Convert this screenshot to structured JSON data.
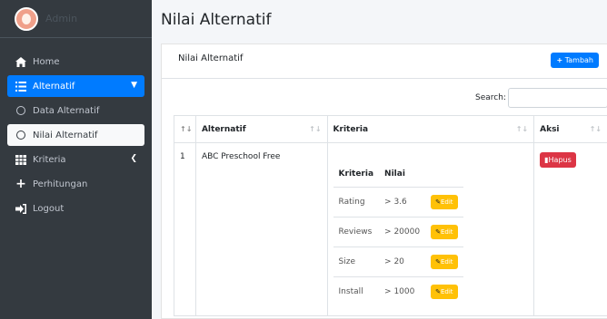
{
  "sidebar": {
    "brand": "Admin",
    "items": [
      {
        "label": "Home",
        "icon": "home-icon"
      },
      {
        "label": "Alternatif",
        "icon": "list-icon"
      },
      {
        "label": "Data Alternatif",
        "icon": "circle-icon"
      },
      {
        "label": "Nilai Alternatif",
        "icon": "circle-icon"
      },
      {
        "label": "Kriteria",
        "icon": "table-icon"
      },
      {
        "label": "Perhitungan",
        "icon": "plus-icon"
      },
      {
        "label": "Logout",
        "icon": "sign-out-icon"
      }
    ]
  },
  "page": {
    "title": "Nilai Alternatif"
  },
  "card": {
    "title": "Nilai Alternatif",
    "add_label": "Tambah",
    "search_label": "Search:"
  },
  "table": {
    "headers": [
      "Alternatif",
      "Kriteria",
      "Aksi"
    ],
    "rows": [
      {
        "no": "1",
        "alternatif": "ABC Preschool Free",
        "inner_headers": [
          "Kriteria",
          "Nilai"
        ],
        "inner": [
          {
            "kriteria": "Rating",
            "nilai": "> 3.6"
          },
          {
            "kriteria": "Reviews",
            "nilai": "> 20000"
          },
          {
            "kriteria": "Size",
            "nilai": "> 20"
          },
          {
            "kriteria": "Install",
            "nilai": "> 1000"
          }
        ],
        "edit_label": "Edit",
        "delete_label": "Hapus"
      }
    ]
  },
  "colors": {
    "sidebar": "#343a40",
    "primary": "#007bff",
    "warning": "#ffc107",
    "danger": "#dc3545"
  }
}
